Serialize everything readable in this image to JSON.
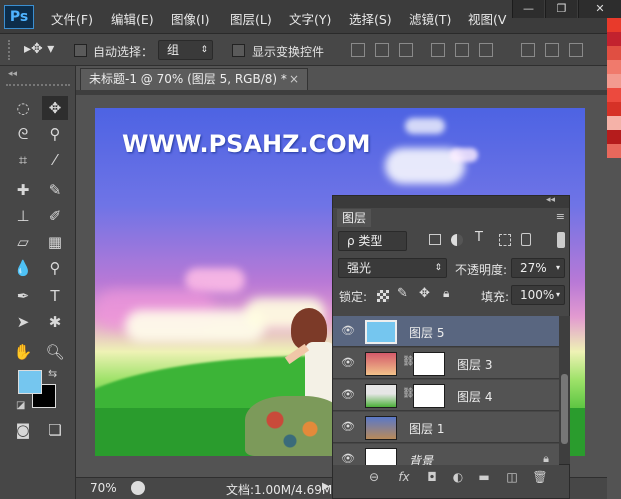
{
  "app": {
    "logo": "Ps"
  },
  "menu": [
    "文件(F)",
    "编辑(E)",
    "图像(I)",
    "图层(L)",
    "文字(Y)",
    "选择(S)",
    "滤镜(T)",
    "视图(V"
  ],
  "window_controls": [
    "—",
    "❐",
    "✕"
  ],
  "options": {
    "auto_select_label": "自动选择：",
    "auto_select_value": "组",
    "show_transform_label": "显示变换控件"
  },
  "document": {
    "tab_title": "未标题-1 @ 70% (图层 5, RGB/8) *",
    "tab_close": "×",
    "watermark": "WWW.PSAHZ.COM"
  },
  "status": {
    "zoom": "70%",
    "doc_info": "文档:1.00M/4.69M"
  },
  "layers_panel": {
    "title": "图层",
    "filter_label": "ρ 类型",
    "blend_mode": "强光",
    "opacity_label": "不透明度:",
    "opacity_value": "27%",
    "lock_label": "锁定:",
    "fill_label": "填充:",
    "fill_value": "100%",
    "layers": [
      {
        "name": "图层 5",
        "selected": true
      },
      {
        "name": "图层 3",
        "selected": false
      },
      {
        "name": "图层 4",
        "selected": false
      },
      {
        "name": "图层 1",
        "selected": false
      },
      {
        "name": "背景",
        "selected": false
      }
    ],
    "footer_icons": [
      "link-icon",
      "fx-icon",
      "mask-icon",
      "adjustment-icon",
      "folder-icon",
      "new-layer-icon",
      "trash-icon"
    ],
    "footer_labels": [
      "⊖",
      "fx",
      "◘",
      "◐",
      "▬",
      "◫",
      "🗑"
    ]
  },
  "colors": {
    "foreground": "#75c6ef",
    "background": "#000000",
    "swatches": [
      "#e83a2b",
      "#c2222e",
      "#e04f42",
      "#f07a6c",
      "#f39a8f",
      "#ec4a3e",
      "#d63227",
      "#f5b2a8",
      "#b51c1c",
      "#e8685c"
    ]
  }
}
